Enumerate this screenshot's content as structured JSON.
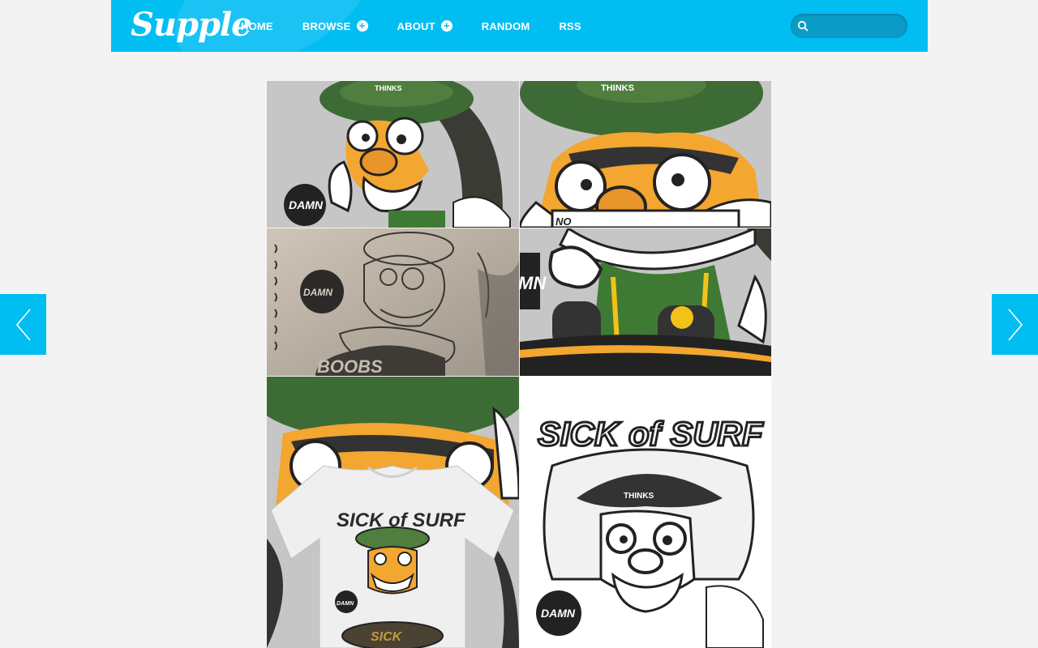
{
  "site": {
    "logo_text": "Supple",
    "nav": [
      {
        "label": "HOME",
        "has_submenu": false
      },
      {
        "label": "BROWSE",
        "has_submenu": true
      },
      {
        "label": "ABOUT",
        "has_submenu": true
      },
      {
        "label": "RANDOM",
        "has_submenu": false
      },
      {
        "label": "RSS",
        "has_submenu": false
      }
    ],
    "submenu_glyph": "+",
    "search": {
      "placeholder": "",
      "value": ""
    },
    "colors": {
      "accent": "#00bdf2",
      "background": "#f3f3f3",
      "search_bg": "#0a9cc7"
    }
  },
  "pager": {
    "prev_icon": "chevron-left-icon",
    "next_icon": "chevron-right-icon"
  },
  "gallery": {
    "tiles": [
      {
        "badge": "DAMN",
        "cap": "THINKS",
        "mask": ""
      },
      {
        "badge": "",
        "cap": "THINKS",
        "mask": "NO"
      },
      {
        "badge": "DAMN",
        "cap": "",
        "board": "BOOBS"
      },
      {
        "badge": "MN",
        "cap": ""
      },
      {
        "badge": "DAMN",
        "title": "SICK of SURF",
        "board": "SICK"
      },
      {
        "badge": "DAMN",
        "title": "SICK of SURF",
        "cap": "THINKS"
      }
    ]
  }
}
